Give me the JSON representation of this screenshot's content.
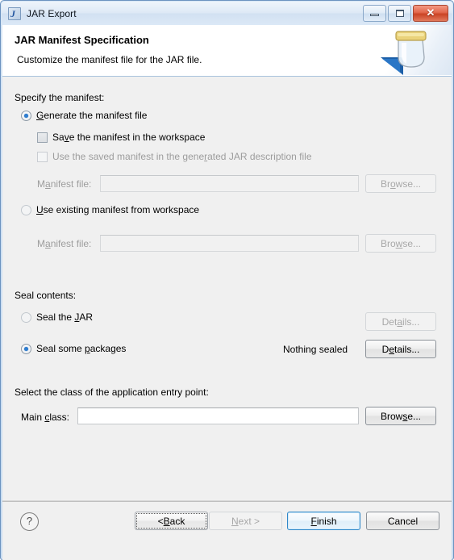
{
  "window": {
    "title": "JAR Export",
    "app_icon": "jar-export-icon",
    "controls": {
      "minimize": "minimize-icon",
      "maximize": "maximize-icon",
      "close": "✕"
    }
  },
  "header": {
    "title": "JAR Manifest Specification",
    "subtitle": "Customize the manifest file for the JAR file.",
    "art": "jar-illustration"
  },
  "manifest": {
    "section_label": "Specify the manifest:",
    "generate": {
      "label_pre": "",
      "label_mn": "G",
      "label_post": "enerate the manifest file",
      "full_label": "Generate the manifest file",
      "checked": true
    },
    "save_in_workspace": {
      "label_pre": "Sa",
      "label_mn": "v",
      "label_post": "e the manifest in the workspace",
      "full_label": "Save the manifest in the workspace",
      "checked": false,
      "enabled": true
    },
    "use_saved_manifest": {
      "label_pre": "Use the saved manifest in the gene",
      "label_mn": "r",
      "label_post": "ated JAR description file",
      "full_label": "Use the saved manifest in the generated JAR description file",
      "checked": false,
      "enabled": false
    },
    "manifest_file_1": {
      "label_pre": "M",
      "label_mn": "a",
      "label_post": "nifest file:",
      "full_label": "Manifest file:",
      "value": "",
      "enabled": false,
      "browse_pre": "Br",
      "browse_mn": "o",
      "browse_post": "wse...",
      "browse_label": "Browse...",
      "browse_enabled": false
    },
    "use_existing": {
      "label_pre": "",
      "label_mn": "U",
      "label_post": "se existing manifest from workspace",
      "full_label": "Use existing manifest from workspace",
      "checked": false
    },
    "manifest_file_2": {
      "label_pre": "M",
      "label_mn": "a",
      "label_post": "nifest file:",
      "full_label": "Manifest file:",
      "value": "",
      "enabled": false,
      "browse_pre": "Bro",
      "browse_mn": "w",
      "browse_post": "se...",
      "browse_label": "Browse...",
      "browse_enabled": false
    }
  },
  "seal": {
    "section_label": "Seal contents:",
    "seal_jar": {
      "label_pre": "Seal the ",
      "label_mn": "J",
      "label_post": "AR",
      "full_label": "Seal the JAR",
      "checked": false,
      "details_pre": "Det",
      "details_mn": "a",
      "details_post": "ils...",
      "details_label": "Details...",
      "details_enabled": false
    },
    "seal_packages": {
      "label_pre": "Seal some ",
      "label_mn": "p",
      "label_post": "ackages",
      "full_label": "Seal some packages",
      "checked": true,
      "status": "Nothing sealed",
      "details_pre": "D",
      "details_mn": "e",
      "details_post": "tails...",
      "details_label": "Details...",
      "details_enabled": true
    }
  },
  "entry_point": {
    "section_label": "Select the class of the application entry point:",
    "main_class": {
      "label_pre": "Main ",
      "label_mn": "c",
      "label_post": "lass:",
      "full_label": "Main class:",
      "value": "",
      "enabled": true,
      "browse_pre": "Brow",
      "browse_mn": "s",
      "browse_post": "e...",
      "browse_label": "Browse...",
      "browse_enabled": true
    }
  },
  "footer": {
    "help": "?",
    "back": {
      "pre": "< ",
      "mn": "B",
      "post": "ack",
      "label": "< Back",
      "enabled": true,
      "focused": true
    },
    "next": {
      "pre": "",
      "mn": "N",
      "post": "ext >",
      "label": "Next >",
      "enabled": false
    },
    "finish": {
      "pre": "",
      "mn": "F",
      "post": "inish",
      "label": "Finish",
      "enabled": true,
      "default": true
    },
    "cancel": {
      "pre": "Cancel",
      "mn": "",
      "post": "",
      "label": "Cancel",
      "enabled": true
    }
  },
  "colors": {
    "accent": "#2f7ed0",
    "close_button": "#ca4324",
    "body_bg": "#f0f0f0",
    "window_border": "#6c93c0"
  }
}
